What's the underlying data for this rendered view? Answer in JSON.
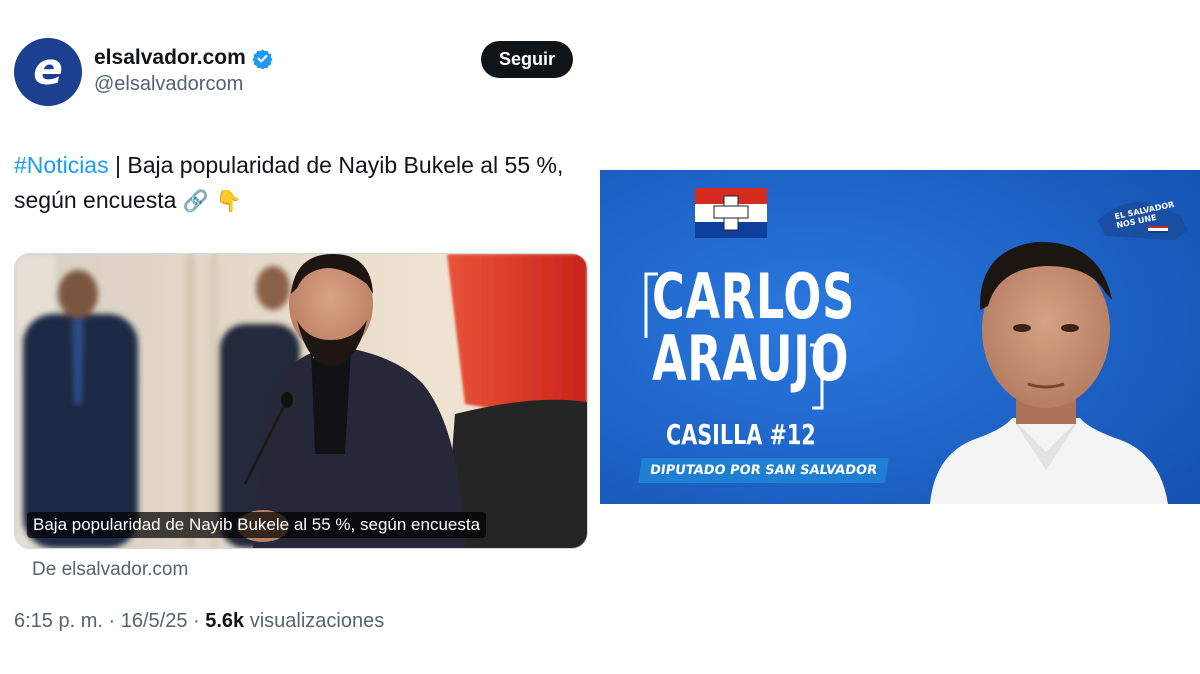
{
  "tweet": {
    "avatar_letter": "e",
    "display_name": "elsalvador.com",
    "handle": "@elsalvadorcom",
    "follow_label": "Seguir",
    "text_hashtag": "#Noticias",
    "text_body": " | Baja popularidad de Nayib Bukele al 55 %, según encuesta ",
    "text_emojis": "🔗 👇",
    "card": {
      "caption": "Baja popularidad de Nayib Bukele al 55 %, según encuesta",
      "source": "De elsalvador.com"
    },
    "meta": {
      "time": "6:15 p. m.",
      "separator": " · ",
      "date": "16/5/25",
      "views_count": "5.6k",
      "views_label": " visualizaciones"
    },
    "icons": {
      "verified": "verified-badge-icon",
      "link": "link-emoji",
      "point_down": "pointing-down-emoji"
    }
  },
  "banner": {
    "name_line1": "CARLOS",
    "name_line2": "ARAUJO",
    "casilla": "CASILLA #12",
    "role": "DIPUTADO POR SAN SALVADOR",
    "logo_line1": "EL SALVADOR",
    "logo_line2": "NOS UNE",
    "colors": {
      "background": "#1e63c6",
      "flag_red": "#d52b1e",
      "flag_blue": "#0f3f9c"
    }
  },
  "colors": {
    "link_blue": "#1d9bf0",
    "text_secondary": "#536471",
    "avatar_bg": "#1d3f8f"
  }
}
